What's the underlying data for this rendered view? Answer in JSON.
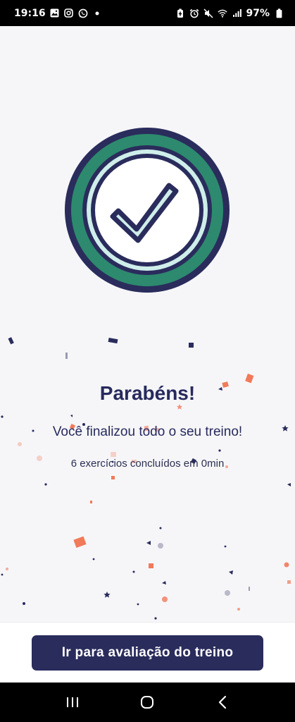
{
  "status_bar": {
    "time": "19:16",
    "battery": "97%",
    "left_icons": [
      "gallery-icon",
      "instagram-icon",
      "whatsapp-icon",
      "dot-icon"
    ],
    "right_icons": [
      "battery-saver-icon",
      "alarm-icon",
      "mute-icon",
      "wifi-icon",
      "signal-icon",
      "battery-icon"
    ]
  },
  "celebration": {
    "title": "Parabéns!",
    "subtitle": "Você finalizou todo o seu treino!",
    "summary": "6 exercícios concluídos em 0min"
  },
  "cta": {
    "label": "Ir para avaliação do treino"
  },
  "colors": {
    "primary": "#2a2c5c",
    "accent_green": "#2d8a6e",
    "confetti_orange": "#f07a5a",
    "confetti_navy": "#2a2c5c",
    "background": "#f6f6f8"
  },
  "nav": {
    "buttons": [
      "recent-apps-icon",
      "home-icon",
      "back-icon"
    ]
  }
}
